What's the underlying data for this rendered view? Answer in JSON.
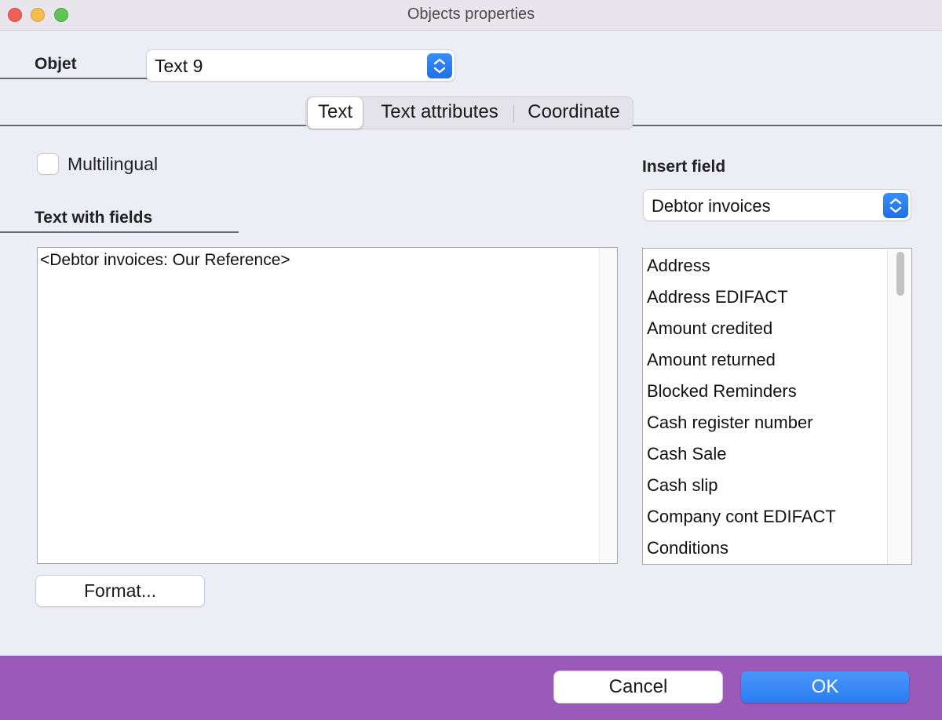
{
  "window": {
    "title": "Objects properties"
  },
  "object": {
    "label": "Objet",
    "selected": "Text 9"
  },
  "tabs": [
    {
      "label": "Text",
      "active": true
    },
    {
      "label": "Text attributes",
      "active": false
    },
    {
      "label": "Coordinate",
      "active": false
    }
  ],
  "multilingual": {
    "label": "Multilingual",
    "checked": false
  },
  "text_with_fields": {
    "label": "Text with fields",
    "value": "<Debtor invoices: Our Reference>"
  },
  "format_button": "Format...",
  "insert_field": {
    "label": "Insert field",
    "selected": "Debtor invoices",
    "items": [
      "Address",
      "Address EDIFACT",
      "Amount credited",
      "Amount returned",
      "Blocked Reminders",
      "Cash register number",
      "Cash Sale",
      "Cash slip",
      "Company cont EDIFACT",
      "Conditions"
    ]
  },
  "footer": {
    "cancel": "Cancel",
    "ok": "OK"
  },
  "colors": {
    "footer_bg": "#9b59b9",
    "accent": "#2a7cf0"
  },
  "icons": [
    "close-window-icon",
    "minimize-window-icon",
    "zoom-window-icon",
    "updown-chevron-icon"
  ]
}
